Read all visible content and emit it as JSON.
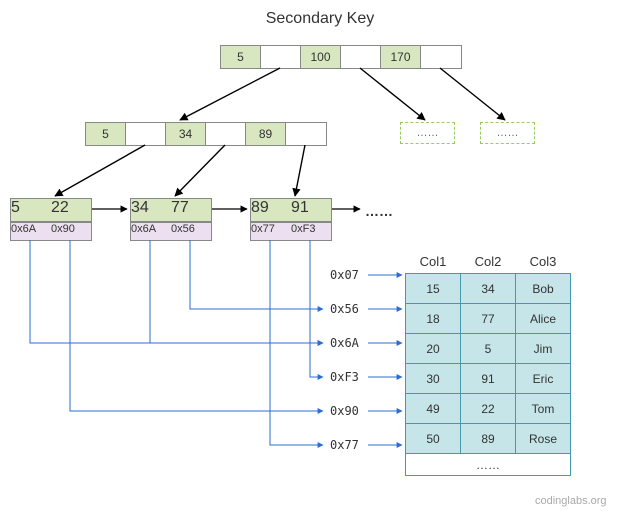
{
  "title": "Secondary Key",
  "root": {
    "keys": [
      "5",
      "100",
      "170"
    ]
  },
  "internal": {
    "keys": [
      "5",
      "34",
      "89"
    ]
  },
  "leaves": [
    {
      "keys": [
        "5",
        "22"
      ],
      "addrs": [
        "0x6A",
        "0x90"
      ]
    },
    {
      "keys": [
        "34",
        "77"
      ],
      "addrs": [
        "0x6A",
        "0x56"
      ]
    },
    {
      "keys": [
        "89",
        "91"
      ],
      "addrs": [
        "0x77",
        "0xF3"
      ]
    }
  ],
  "ghost_label": "……",
  "dots": "……",
  "addr_labels": [
    "0x07",
    "0x56",
    "0x6A",
    "0xF3",
    "0x90",
    "0x77"
  ],
  "table": {
    "headers": [
      "Col1",
      "Col2",
      "Col3"
    ],
    "rows": [
      [
        "15",
        "34",
        "Bob"
      ],
      [
        "18",
        "77",
        "Alice"
      ],
      [
        "20",
        "5",
        "Jim"
      ],
      [
        "30",
        "91",
        "Eric"
      ],
      [
        "49",
        "22",
        "Tom"
      ],
      [
        "50",
        "89",
        "Rose"
      ]
    ],
    "more": "……"
  },
  "watermark": "codinglabs.org"
}
